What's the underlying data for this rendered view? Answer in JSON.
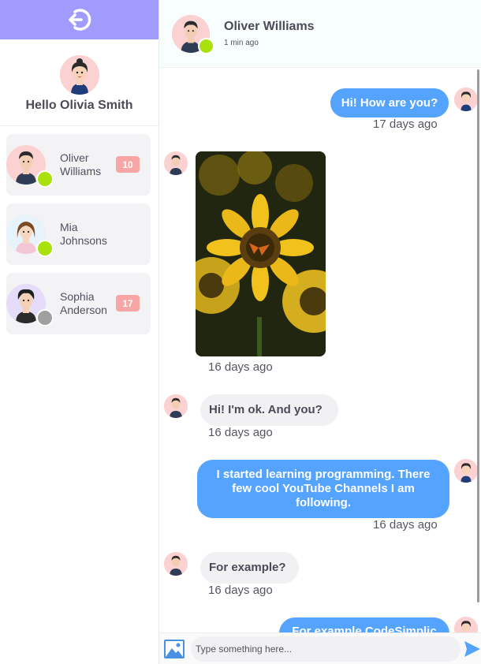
{
  "sidebar": {
    "user_greeting": "Hello Olivia Smith",
    "contacts": [
      {
        "name": "Oliver Williams",
        "unread": "10",
        "status": "online"
      },
      {
        "name": "Mia Johnsons",
        "unread": "",
        "status": "online"
      },
      {
        "name": "Sophia Anderson",
        "unread": "17",
        "status": "offline"
      }
    ]
  },
  "chat": {
    "contact_name": "Oliver Williams",
    "last_seen": "1 min ago",
    "messages": [
      {
        "direction": "out",
        "text": "Hi! How are you?",
        "time": "17 days ago"
      },
      {
        "direction": "in",
        "type": "image",
        "image": "sunflower-butterfly-photo",
        "time": "16 days ago"
      },
      {
        "direction": "in",
        "text": "Hi! I'm ok. And you?",
        "time": "16 days ago"
      },
      {
        "direction": "out",
        "text": "I started learning programming. There few cool YouTube Channels I am following.",
        "time": "16 days ago"
      },
      {
        "direction": "in",
        "text": "For example?",
        "time": "16 days ago"
      },
      {
        "direction": "out",
        "text": "For example CodeSimplic",
        "time": ""
      }
    ]
  },
  "composer": {
    "placeholder": "Type something here..."
  },
  "colors": {
    "accent": "#a29bfe",
    "bubble_out": "#54a3ff",
    "bubble_in": "#f1f1f4",
    "online": "#a8e10c",
    "offline": "#a0a0a0",
    "badge": "#f8a5a5"
  },
  "icons": {
    "logout": "logout-icon",
    "image_upload": "image-icon",
    "send": "send-icon"
  }
}
